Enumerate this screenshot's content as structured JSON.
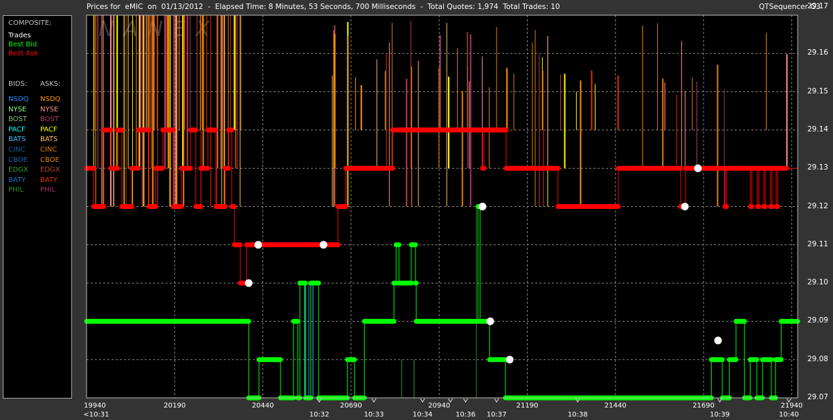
{
  "header": {
    "title": "Prices for  eMIC  on  01/13/2012  -  Elapsed Time: 8 Minutes, 53 Seconds, 700 Milliseconds  -  Total Quotes: 1,974  Total Trades: 10",
    "app_name": "QTSequencer G3"
  },
  "watermark": "NANEX",
  "legend": {
    "composite_label": "COMPOSITE:",
    "composite": [
      {
        "label": "Trades",
        "color": "#ffffff"
      },
      {
        "label": "Best Bid",
        "color": "#00ff00"
      },
      {
        "label": "Best Ask",
        "color": "#ff0000"
      }
    ],
    "bids_label": "BIDS:",
    "asks_label": "ASKS:",
    "bids": [
      {
        "label": "NSDQ",
        "color": "#1e90ff"
      },
      {
        "label": "NYSE",
        "color": "#90ff90"
      },
      {
        "label": "BOST",
        "color": "#80c080"
      },
      {
        "label": "PACF",
        "color": "#00ffff"
      },
      {
        "label": "BATS",
        "color": "#40c0ff"
      },
      {
        "label": "CINC",
        "color": "#1060a0"
      },
      {
        "label": "CBOE",
        "color": "#1868b0"
      },
      {
        "label": "EDGX",
        "color": "#30a030"
      },
      {
        "label": "BATY",
        "color": "#1a70c0"
      },
      {
        "label": "PHIL",
        "color": "#309030"
      }
    ],
    "asks": [
      {
        "label": "NSDQ",
        "color": "#ff9000"
      },
      {
        "label": "NYSE",
        "color": "#ff9090"
      },
      {
        "label": "BOST",
        "color": "#b04060"
      },
      {
        "label": "PACF",
        "color": "#ffff00"
      },
      {
        "label": "BATS",
        "color": "#ffc060"
      },
      {
        "label": "CINC",
        "color": "#e08000"
      },
      {
        "label": "CBOE",
        "color": "#e08000"
      },
      {
        "label": "EDGX",
        "color": "#c04030"
      },
      {
        "label": "BATY",
        "color": "#e03000"
      },
      {
        "label": "PHIL",
        "color": "#b03070"
      }
    ]
  },
  "chart_data": {
    "type": "line",
    "xlim": [
      19940,
      21957
    ],
    "ylim": [
      29.07,
      29.17
    ],
    "grid": true,
    "y_ticks": [
      "29.17",
      "29.16",
      "29.15",
      "29.14",
      "29.13",
      "29.12",
      "29.11",
      "29.10",
      "29.09",
      "29.08",
      "29.07"
    ],
    "x_ticks": [
      "19940",
      "20190",
      "20440",
      "20690",
      "20940",
      "21190",
      "21440",
      "21690",
      "21940"
    ],
    "time_markers": [
      {
        "seq": 19940,
        "label": "<10:31"
      },
      {
        "seq": 20600,
        "label": "10:32"
      },
      {
        "seq": 20755,
        "label": "10:33"
      },
      {
        "seq": 20893,
        "label": "10:34"
      },
      {
        "seq": 20972,
        "label": ""
      },
      {
        "seq": 21015,
        "label": "10:36"
      },
      {
        "seq": 21103,
        "label": "10:37"
      },
      {
        "seq": 21333,
        "label": "10:38"
      },
      {
        "seq": 21736,
        "label": "10:39"
      },
      {
        "seq": 21932,
        "label": "10:40"
      }
    ],
    "series": [
      {
        "name": "Best Bid",
        "color": "#00ff00",
        "steps": [
          [
            19940,
            29.09
          ],
          [
            20400,
            29.07
          ],
          [
            20429,
            29.08
          ],
          [
            20490,
            29.07
          ],
          [
            20527,
            29.09
          ],
          [
            20539,
            29.07
          ],
          [
            20545,
            29.1
          ],
          [
            20561,
            29.07
          ],
          [
            20576,
            29.1
          ],
          [
            20598,
            29.07
          ],
          [
            20680,
            29.08
          ],
          [
            20700,
            29.07
          ],
          [
            20728,
            29.09
          ],
          [
            20812,
            29.1
          ],
          [
            20818,
            29.11
          ],
          [
            20826,
            29.1
          ],
          [
            20861,
            29.11
          ],
          [
            20873,
            29.1
          ],
          [
            20875,
            29.09
          ],
          [
            21050,
            29.12
          ],
          [
            21056,
            29.09
          ],
          [
            21083,
            29.08
          ],
          [
            21128,
            29.07
          ],
          [
            21712,
            29.08
          ],
          [
            21743,
            29.07
          ],
          [
            21763,
            29.08
          ],
          [
            21782,
            29.09
          ],
          [
            21806,
            29.07
          ],
          [
            21822,
            29.08
          ],
          [
            21841,
            29.07
          ],
          [
            21857,
            29.08
          ],
          [
            21882,
            29.07
          ],
          [
            21894,
            29.08
          ],
          [
            21910,
            29.09
          ]
        ]
      },
      {
        "name": "Best Ask",
        "color": "#ff0000",
        "steps": [
          [
            19940,
            29.13
          ],
          [
            19960,
            29.12
          ],
          [
            19989,
            29.14
          ],
          [
            20009,
            29.13
          ],
          [
            20028,
            29.14
          ],
          [
            20040,
            29.12
          ],
          [
            20068,
            29.13
          ],
          [
            20087,
            29.14
          ],
          [
            20117,
            29.12
          ],
          [
            20136,
            29.13
          ],
          [
            20156,
            29.14
          ],
          [
            20186,
            29.12
          ],
          [
            20209,
            29.13
          ],
          [
            20235,
            29.14
          ],
          [
            20250,
            29.12
          ],
          [
            20264,
            29.13
          ],
          [
            20284,
            29.14
          ],
          [
            20307,
            29.12
          ],
          [
            20333,
            29.13
          ],
          [
            20343,
            29.14
          ],
          [
            20352,
            29.12
          ],
          [
            20359,
            29.11
          ],
          [
            20376,
            29.1
          ],
          [
            20394,
            29.11
          ],
          [
            20653,
            29.12
          ],
          [
            20675,
            29.13
          ],
          [
            20808,
            29.14
          ],
          [
            21063,
            29.13
          ],
          [
            21067,
            29.14
          ],
          [
            21130,
            29.13
          ],
          [
            21277,
            29.12
          ],
          [
            21448,
            29.13
          ],
          [
            21625,
            29.12
          ],
          [
            21639,
            29.13
          ],
          [
            21751,
            29.12
          ],
          [
            21755,
            29.13
          ],
          [
            21823,
            29.12
          ],
          [
            21827,
            29.13
          ],
          [
            21843,
            29.12
          ],
          [
            21847,
            29.13
          ],
          [
            21861,
            29.12
          ],
          [
            21865,
            29.13
          ],
          [
            21880,
            29.12
          ],
          [
            21884,
            29.13
          ],
          [
            21896,
            29.12
          ],
          [
            21900,
            29.13
          ]
        ]
      },
      {
        "name": "Trades",
        "color": "#ffffff",
        "points": [
          [
            20400,
            29.1
          ],
          [
            20427,
            29.11
          ],
          [
            20612,
            29.11
          ],
          [
            21063,
            29.12
          ],
          [
            21085,
            29.09
          ],
          [
            21140,
            29.08
          ],
          [
            21637,
            29.12
          ],
          [
            21674,
            29.13
          ],
          [
            21731,
            29.085
          ]
        ]
      }
    ]
  }
}
